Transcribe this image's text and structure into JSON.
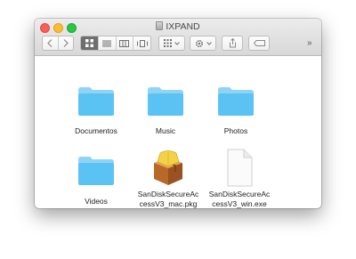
{
  "window": {
    "title": "IXPAND"
  },
  "toolbar": {
    "back_icon": "chevron-left-icon",
    "forward_icon": "chevron-right-icon",
    "view_icons": "icon-view-icon",
    "view_list": "list-view-icon",
    "view_columns": "column-view-icon",
    "view_coverflow": "coverflow-view-icon",
    "arrange_icon": "arrange-grid-icon",
    "action_icon": "gear-icon",
    "share_icon": "share-icon",
    "tags_icon": "tag-icon",
    "overflow": "»"
  },
  "files": [
    {
      "name": "Documentos",
      "kind": "folder"
    },
    {
      "name": "Music",
      "kind": "folder"
    },
    {
      "name": "Photos",
      "kind": "folder"
    },
    {
      "name": "Videos",
      "kind": "folder"
    },
    {
      "name_line1": "SanDiskSecureAc",
      "name_line2": "cessV3_mac.pkg",
      "kind": "package"
    },
    {
      "name_line1": "SanDiskSecureAc",
      "name_line2": "cessV3_win.exe",
      "kind": "document"
    }
  ],
  "colors": {
    "folder_front": "#5bc3f3",
    "folder_back": "#8fd3f6",
    "close": "#fc5f57",
    "minimize": "#fdbc2e",
    "zoom": "#28c840"
  }
}
